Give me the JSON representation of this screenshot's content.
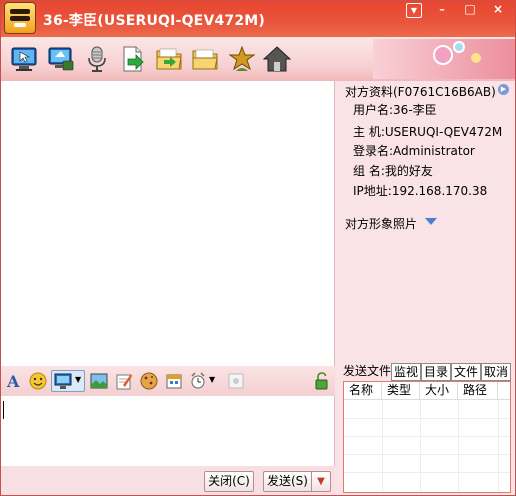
{
  "window": {
    "title": "36-李臣(USERUQI-QEV472M)",
    "controls": {
      "menu": "▼",
      "minimize": "–",
      "maximize": "□",
      "close": "×"
    }
  },
  "toolbar": {
    "icons": [
      "remote-assist-icon",
      "video-icon",
      "microphone-icon",
      "send-file-icon",
      "send-folder-icon",
      "folder-icon",
      "game-icon",
      "home-icon"
    ]
  },
  "input_toolbar": {
    "icons": [
      "font-icon",
      "emoticon-icon",
      "screenshot-icon",
      "image-icon",
      "note-icon",
      "cookie-icon",
      "calendar-icon",
      "shake-icon",
      "settings-icon"
    ],
    "lock_icon": "unlock-icon"
  },
  "buttons": {
    "close_label": "关闭(C)",
    "send_label": "发送(S)",
    "send_dropdown": "▼"
  },
  "contact_info": {
    "header": "对方资料(F0761C16B6AB)",
    "rows": [
      {
        "text": "用户名:36-李臣"
      },
      {
        "text": "主  机:USERUQI-QEV472M"
      },
      {
        "text": "登录名:Administrator"
      },
      {
        "text": "组  名:我的好友"
      },
      {
        "text": "IP地址:192.168.170.38"
      }
    ],
    "photo_header": "对方形象照片"
  },
  "file_panel": {
    "tabs": [
      "发送文件",
      "监视",
      "目录",
      "文件",
      "取消"
    ],
    "columns": [
      "名称",
      "类型",
      "大小",
      "路径"
    ]
  },
  "colors": {
    "title_bar": "#e9452f",
    "panel_bg": "#f7dfe3",
    "list_border": "#e07a70"
  }
}
